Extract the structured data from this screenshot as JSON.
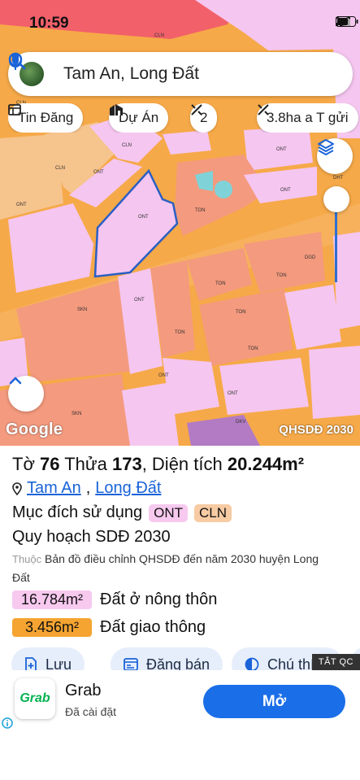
{
  "status_bar": {
    "time": "10:59"
  },
  "search": {
    "query": "Tam An, Long Đất"
  },
  "chips": [
    {
      "label": "Tin Đăng",
      "icon": "listing-icon"
    },
    {
      "label": "Dự Án",
      "icon": "project-building-icon"
    },
    {
      "label": "2",
      "icon": "measure-tool-icon"
    },
    {
      "label": "3.8ha a T gửi",
      "icon": "measure-tool-icon"
    }
  ],
  "map": {
    "attribution": "Google",
    "layer_label": "QHSDĐ 2030",
    "zone_labels": [
      "CLN",
      "CLN",
      "CLN",
      "CLN",
      "ONT",
      "ONT",
      "ONT",
      "ONT",
      "ONT",
      "ONT",
      "ONT",
      "ONT",
      "TON",
      "TON",
      "TON",
      "TON",
      "TON",
      "TON",
      "DGD",
      "SKN",
      "SKN",
      "DHT",
      "DKV"
    ],
    "colors": {
      "road": "#f6a948",
      "residential": "#f5c6ef",
      "commercial": "#f49a7e",
      "agri": "#f6c48d",
      "selection": "#2b5fc4"
    }
  },
  "panel": {
    "title_prefix": "Tờ",
    "sheet_no": "76",
    "parcel_label": "Thửa",
    "parcel_no": "173",
    "area_label": "Diện tích",
    "area_value": "20.244m²",
    "location": {
      "commune": "Tam An",
      "district": "Long Đất"
    },
    "purpose_label": "Mục đích sử dụng",
    "purpose_tags": [
      "ONT",
      "CLN"
    ],
    "plan_label": "Quy hoạch SDĐ 2030",
    "source_prefix": "Thuộc",
    "source_text": "Bản đồ điều chỉnh QHSDĐ đến năm 2030 huyện Long Đất",
    "areas": [
      {
        "value": "16.784m²",
        "label": "Đất ở nông thôn",
        "color": "#f7c9ef"
      },
      {
        "value": "3.456m²",
        "label": "Đất giao thông",
        "color": "#f5a431"
      }
    ],
    "actions": [
      {
        "label": "Lưu",
        "icon": "add-document-icon"
      },
      {
        "label": "Đăng bán",
        "icon": "post-listing-icon"
      },
      {
        "label": "Chú thích",
        "icon": "legend-contrast-icon"
      }
    ]
  },
  "ad": {
    "close_label": "TẮT QC",
    "icon_text": "Grab",
    "title": "Grab",
    "subtitle": "Đã cài đặt",
    "cta": "Mở"
  }
}
